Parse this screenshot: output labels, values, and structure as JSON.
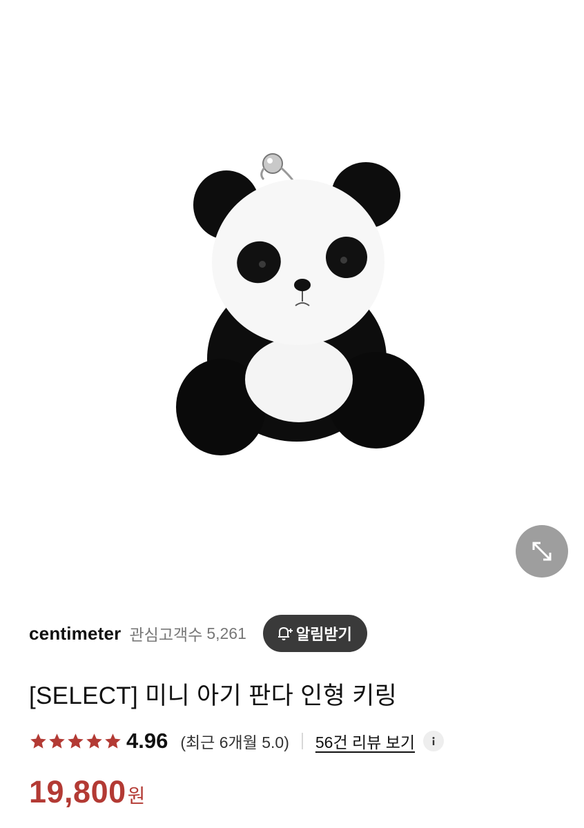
{
  "shop": {
    "name": "centimeter",
    "follower_label": "관심고객수",
    "follower_count": "5,261",
    "notify_label": "알림받기"
  },
  "product": {
    "title": "[SELECT] 미니 아기 판다 인형 키링",
    "image_alt": "panda plush keyring"
  },
  "rating": {
    "stars": 5,
    "score": "4.96",
    "recent": "(최근 6개월 5.0)",
    "review_link": "56건 리뷰 보기"
  },
  "price": {
    "value": "19,800",
    "unit": "원"
  },
  "colors": {
    "star": "#b33a34",
    "price": "#b33a34",
    "notify_bg": "#3a3a3a",
    "expand_bg": "#9e9e9e"
  },
  "icons": [
    "expand-icon",
    "bell-plus-icon",
    "star-icon",
    "info-icon"
  ]
}
